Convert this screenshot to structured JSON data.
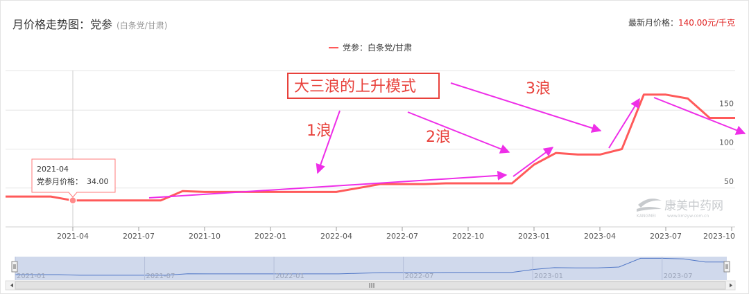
{
  "header": {
    "title": "月价格走势图：党参",
    "subtitle": "(白条党/甘肃)",
    "latest_label": "最新月价格：",
    "latest_value": "140.00元/千克"
  },
  "tooltip": {
    "date": "2021-04",
    "label": "党参月价格：",
    "value": "34.00"
  },
  "annotations": {
    "box_text": "大三浪的上升模式",
    "wave1": "1浪",
    "wave2": "2浪",
    "wave3": "3浪"
  },
  "watermark": {
    "cn": "康美中药网",
    "en": "KANGMEI",
    "url": "www.kmzyw.com.cn"
  },
  "colors": {
    "series": "#ff5a5a",
    "annotation_red": "#e8413b",
    "arrow": "#ee2ee8",
    "navigator_fill": "#c9d3ea",
    "navigator_line": "#4f76c6"
  },
  "chart_data": {
    "type": "line",
    "legend": "党参：白条党/甘肃",
    "x_ticks": [
      "2021-04",
      "2021-07",
      "2021-10",
      "2022-01",
      "2022-04",
      "2022-07",
      "2022-10",
      "2023-01",
      "2023-04",
      "2023-07",
      "2023-10"
    ],
    "y_ticks": [
      50,
      100,
      150
    ],
    "ylim": [
      0,
      200
    ],
    "grid": true,
    "series": [
      {
        "name": "党参：白条党/甘肃",
        "x": [
          "2021-01",
          "2021-02",
          "2021-03",
          "2021-04",
          "2021-05",
          "2021-06",
          "2021-07",
          "2021-08",
          "2021-09",
          "2021-10",
          "2021-11",
          "2021-12",
          "2022-01",
          "2022-02",
          "2022-03",
          "2022-04",
          "2022-05",
          "2022-06",
          "2022-07",
          "2022-08",
          "2022-09",
          "2022-10",
          "2022-11",
          "2022-12",
          "2023-01",
          "2023-02",
          "2023-03",
          "2023-04",
          "2023-05",
          "2023-06",
          "2023-07",
          "2023-08",
          "2023-09",
          "2023-10"
        ],
        "values": [
          39,
          39,
          39,
          34,
          34,
          34,
          34,
          34,
          46,
          45,
          45,
          45,
          45,
          45,
          45,
          45,
          50,
          55,
          55,
          55,
          56,
          56,
          56,
          56,
          80,
          95,
          93,
          93,
          100,
          170,
          170,
          165,
          140,
          140
        ]
      }
    ],
    "navigator": {
      "x_ticks": [
        "2021-01",
        "2021-07",
        "2022-01",
        "2022-07",
        "2023-01",
        "2023-07"
      ],
      "range": [
        "2021-01",
        "2023-10"
      ]
    }
  }
}
